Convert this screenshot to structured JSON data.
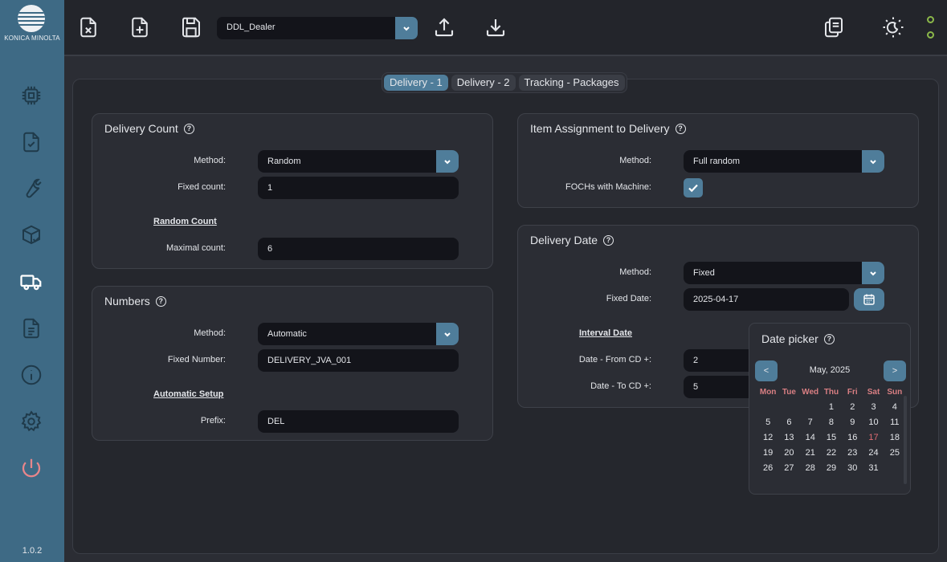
{
  "sidebar": {
    "logo_text": "KONICA MINOLTA",
    "nav_icons": [
      "chip-icon",
      "document-check-icon",
      "wrench-icon",
      "package-check-icon",
      "truck-icon",
      "document-text-icon",
      "info-icon",
      "gear-icon",
      "power-icon"
    ],
    "active_item": "truck-icon",
    "version": "1.0.2"
  },
  "toolbar": {
    "profile_value": "DDL_Dealer",
    "buttons": [
      "close-file-icon",
      "new-file-icon",
      "save-icon",
      "upload-icon",
      "download-icon",
      "copy-icon",
      "theme-toggle-icon"
    ]
  },
  "tabs": [
    {
      "label": "Delivery - 1",
      "active": true
    },
    {
      "label": "Delivery - 2",
      "active": false
    },
    {
      "label": "Tracking - Packages",
      "active": false
    }
  ],
  "delivery_count": {
    "title": "Delivery Count",
    "method_label": "Method:",
    "method_value": "Random",
    "fixed_count_label": "Fixed count:",
    "fixed_count_value": "1",
    "section_title": "Random Count",
    "max_count_label": "Maximal count:",
    "max_count_value": "6"
  },
  "numbers": {
    "title": "Numbers",
    "method_label": "Method:",
    "method_value": "Automatic",
    "fixed_number_label": "Fixed Number:",
    "fixed_number_value": "DELIVERY_JVA_001",
    "section_title": "Automatic Setup",
    "prefix_label": "Prefix:",
    "prefix_value": "DEL"
  },
  "item_assignment": {
    "title": "Item Assignment to Delivery",
    "method_label": "Method:",
    "method_value": "Full random",
    "foch_label": "FOCHs with Machine:",
    "foch_checked": true
  },
  "delivery_date": {
    "title": "Delivery Date",
    "method_label": "Method:",
    "method_value": "Fixed",
    "fixed_date_label": "Fixed Date:",
    "fixed_date_value": "2025-04-17",
    "section_title": "Interval Date",
    "from_label": "Date - From CD +:",
    "from_value": "2",
    "to_label": "Date - To CD +:",
    "to_value": "5"
  },
  "date_picker": {
    "title": "Date picker",
    "prev": "<",
    "next": ">",
    "month": "May, 2025",
    "weekdays": [
      "Mon",
      "Tue",
      "Wed",
      "Thu",
      "Fri",
      "Sat",
      "Sun"
    ],
    "weeks": [
      [
        "",
        "",
        "",
        "1",
        "2",
        "3",
        "4"
      ],
      [
        "5",
        "6",
        "7",
        "8",
        "9",
        "10",
        "11"
      ],
      [
        "12",
        "13",
        "14",
        "15",
        "16",
        "17",
        "18"
      ],
      [
        "19",
        "20",
        "21",
        "22",
        "23",
        "24",
        "25"
      ],
      [
        "26",
        "27",
        "28",
        "29",
        "30",
        "31",
        ""
      ]
    ],
    "highlighted_day": "17",
    "highlight_color": "#e06c73"
  },
  "colors": {
    "accent": "#4f7d9a",
    "sidebar": "#3e6a85",
    "status_ok": "#8bb84a",
    "power": "#e8868b"
  }
}
